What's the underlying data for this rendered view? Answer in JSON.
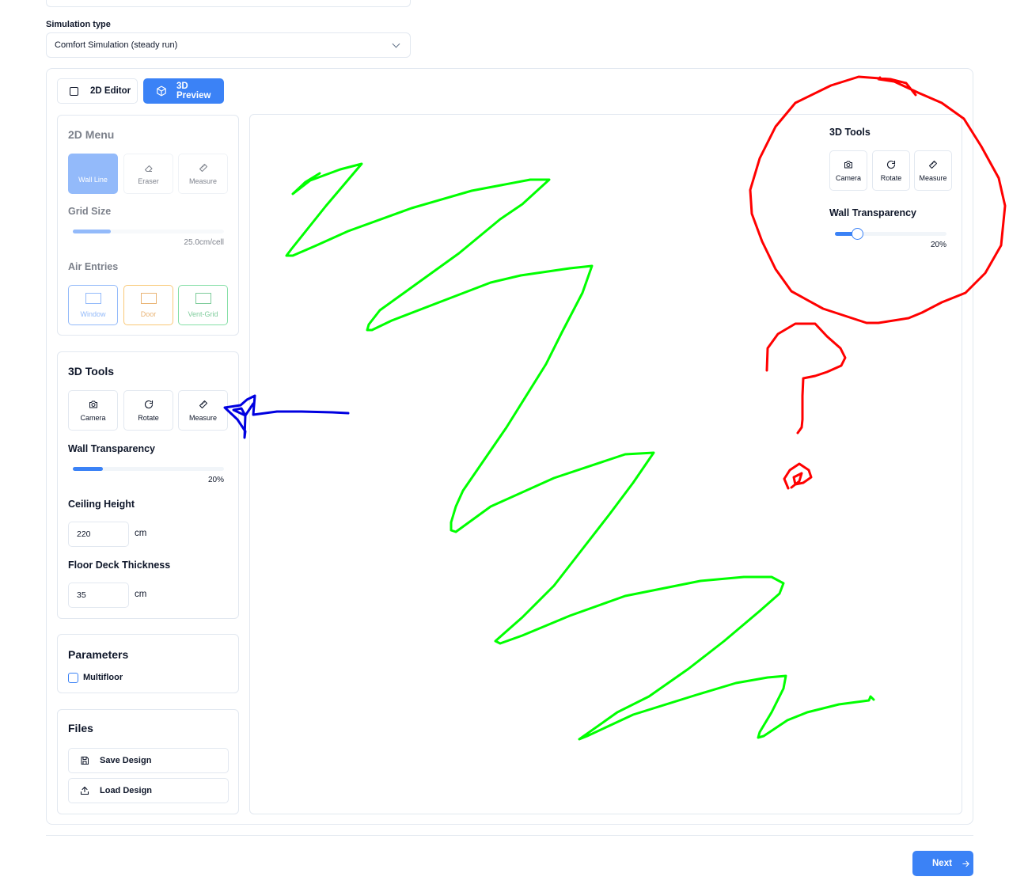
{
  "simulation": {
    "label": "Simulation type",
    "selected": "Comfort Simulation (steady run)"
  },
  "tabs": {
    "editor_2d": "2D Editor",
    "preview_3d": "3D Preview"
  },
  "menu_2d": {
    "title": "2D Menu",
    "tools": [
      "Wall Line",
      "Eraser",
      "Measure"
    ],
    "grid_size_label": "Grid Size",
    "grid_size_value": "25.0cm/cell",
    "grid_size_fraction": 0.25,
    "air_entries_label": "Air Entries",
    "air_entries": [
      "Window",
      "Door",
      "Vent-Grid"
    ]
  },
  "tools_3d": {
    "title": "3D Tools",
    "tools": [
      "Camera",
      "Rotate",
      "Measure"
    ],
    "wall_transparency_label": "Wall Transparency",
    "wall_transparency_value": "20%",
    "wall_transparency_fraction": 0.2,
    "ceiling_height_label": "Ceiling Height",
    "ceiling_height_value": "220",
    "ceiling_height_unit": "cm",
    "floor_deck_label": "Floor Deck Thickness",
    "floor_deck_value": "35",
    "floor_deck_unit": "cm"
  },
  "parameters": {
    "title": "Parameters",
    "multifloor_label": "Multifloor",
    "multifloor_checked": false
  },
  "files": {
    "title": "Files",
    "save_label": "Save Design",
    "load_label": "Load Design"
  },
  "canvas_tools": {
    "title": "3D Tools",
    "tools": [
      "Camera",
      "Rotate",
      "Measure"
    ],
    "wall_transparency_label": "Wall Transparency",
    "wall_transparency_value": "20%",
    "wall_transparency_fraction": 0.2
  },
  "footer": {
    "next_label": "Next"
  },
  "colors": {
    "accent": "#3b82f6",
    "annotation_green": "#00ff00",
    "annotation_red": "#ff0000",
    "annotation_blue": "#0000e0"
  }
}
